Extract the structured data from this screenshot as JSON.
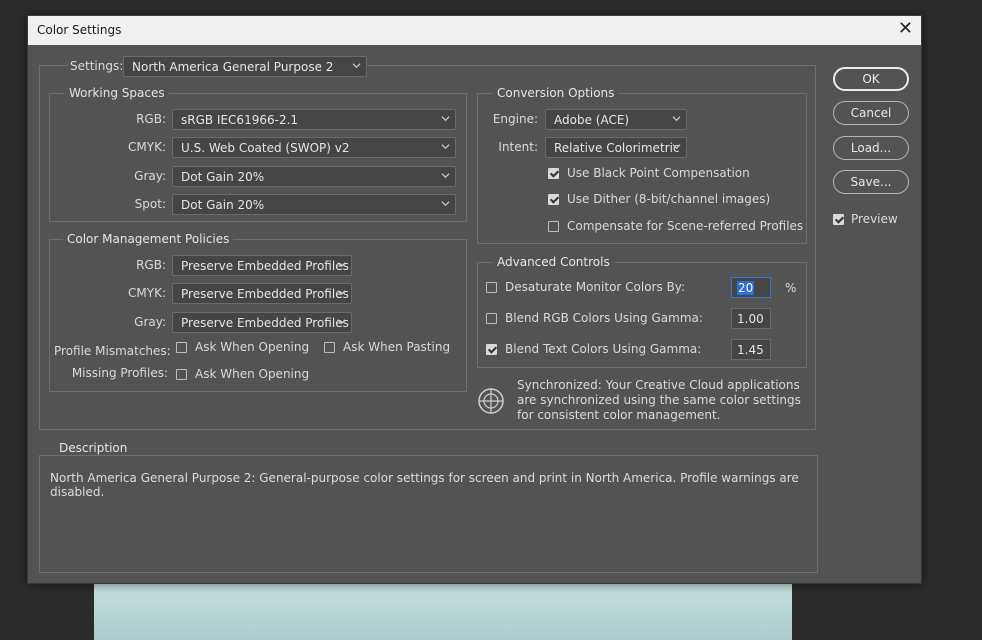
{
  "window": {
    "title": "Color Settings",
    "close_label": "✕"
  },
  "settings": {
    "label": "Settings:",
    "value": "North America General Purpose 2"
  },
  "working_spaces": {
    "legend": "Working Spaces",
    "rgb_label": "RGB:",
    "rgb_value": "sRGB IEC61966-2.1",
    "cmyk_label": "CMYK:",
    "cmyk_value": "U.S. Web Coated (SWOP) v2",
    "gray_label": "Gray:",
    "gray_value": "Dot Gain 20%",
    "spot_label": "Spot:",
    "spot_value": "Dot Gain 20%"
  },
  "policies": {
    "legend": "Color Management Policies",
    "rgb_label": "RGB:",
    "rgb_value": "Preserve Embedded Profiles",
    "cmyk_label": "CMYK:",
    "cmyk_value": "Preserve Embedded Profiles",
    "gray_label": "Gray:",
    "gray_value": "Preserve Embedded Profiles",
    "mismatch_label": "Profile Mismatches:",
    "ask_opening": "Ask When Opening",
    "ask_pasting": "Ask When Pasting",
    "missing_label": "Missing Profiles:",
    "missing_ask_opening": "Ask When Opening"
  },
  "conversion": {
    "legend": "Conversion Options",
    "engine_label": "Engine:",
    "engine_value": "Adobe (ACE)",
    "intent_label": "Intent:",
    "intent_value": "Relative Colorimetric",
    "black_point": "Use Black Point Compensation",
    "dither": "Use Dither (8-bit/channel images)",
    "scene_referred": "Compensate for Scene-referred Profiles"
  },
  "advanced": {
    "legend": "Advanced Controls",
    "desaturate_label": "Desaturate Monitor Colors By:",
    "desaturate_value": "20",
    "percent": "%",
    "blend_rgb_label": "Blend RGB Colors Using Gamma:",
    "blend_rgb_value": "1.00",
    "blend_text_label": "Blend Text Colors Using Gamma:",
    "blend_text_value": "1.45"
  },
  "sync": {
    "text": "Synchronized: Your Creative Cloud applications are synchronized using the same color settings for consistent color management."
  },
  "description": {
    "legend": "Description",
    "text": "North America General Purpose 2:  General-purpose color settings for screen and print in North America. Profile warnings are disabled."
  },
  "buttons": {
    "ok": "OK",
    "cancel": "Cancel",
    "load": "Load...",
    "save": "Save...",
    "preview": "Preview"
  }
}
